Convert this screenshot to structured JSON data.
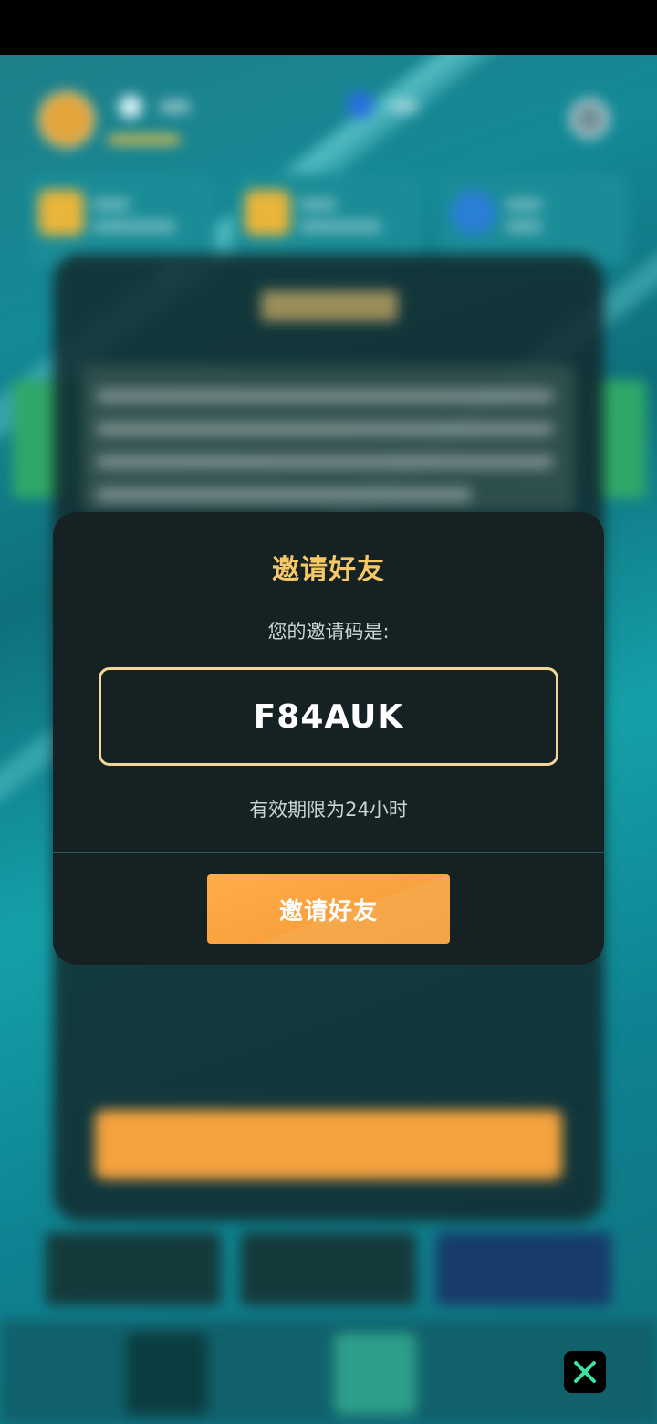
{
  "modal": {
    "title": "邀请好友",
    "code_label": "您的邀请码是:",
    "invite_code": "F84AUK",
    "validity_text": "有效期限为24小时",
    "invite_button_label": "邀请好友"
  },
  "colors": {
    "title": "#f6c766",
    "code_border": "#f3d79a",
    "button": "#f9a13e",
    "close_icon": "#3fe0a0"
  },
  "icons": {
    "close": "close-icon"
  }
}
